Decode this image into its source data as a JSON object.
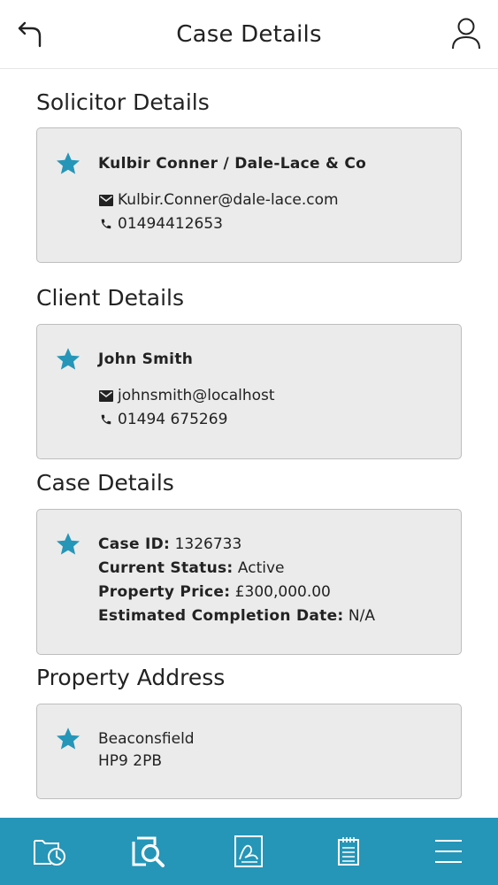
{
  "header": {
    "title": "Case Details"
  },
  "solicitor": {
    "section_title": "Solicitor Details",
    "name": "Kulbir Conner / Dale-Lace & Co",
    "email": "Kulbir.Conner@dale-lace.com",
    "phone": "01494412653"
  },
  "client": {
    "section_title": "Client Details",
    "name": "John Smith",
    "email": "johnsmith@localhost",
    "phone": "01494 675269"
  },
  "case": {
    "section_title": "Case Details",
    "case_id_label": "Case ID:",
    "case_id_value": "1326733",
    "status_label": "Current Status:",
    "status_value": "Active",
    "price_label": "Property Price:",
    "price_value": "£300,000.00",
    "completion_label": "Estimated Completion Date:",
    "completion_value": "N/A"
  },
  "property": {
    "section_title": "Property Address",
    "line1": "Beaconsfield",
    "line2": "HP9 2PB"
  },
  "icons": {
    "back": "back-arrow-icon",
    "profile": "user-icon",
    "star": "star-icon",
    "email": "envelope-icon",
    "phone": "phone-icon",
    "nav": [
      "case-timeline-icon",
      "search-case-icon",
      "documents-sign-icon",
      "notepad-icon",
      "menu-icon"
    ]
  },
  "colors": {
    "accent": "#2596b8",
    "star": "#2596b8",
    "card_bg": "#ebebeb",
    "card_border": "#bdbdbd"
  }
}
